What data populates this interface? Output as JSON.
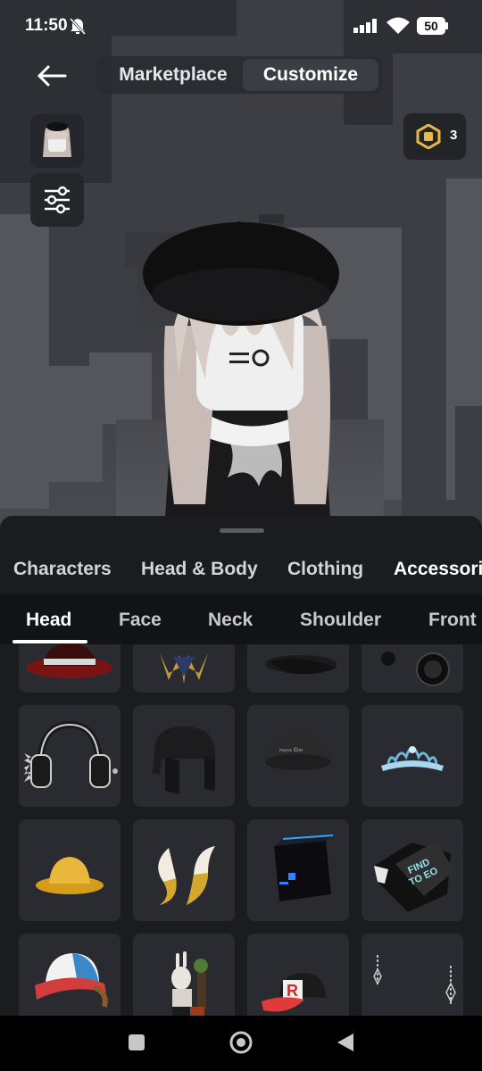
{
  "status_bar": {
    "time": "11:50",
    "battery": "50"
  },
  "header": {
    "tabs": [
      {
        "label": "Marketplace"
      },
      {
        "label": "Customize"
      }
    ],
    "robux_count": "3"
  },
  "categories": [
    {
      "label": "Characters"
    },
    {
      "label": "Head & Body"
    },
    {
      "label": "Clothing"
    },
    {
      "label": "Accessories"
    }
  ],
  "subcategories": [
    {
      "label": "Head"
    },
    {
      "label": "Face"
    },
    {
      "label": "Neck"
    },
    {
      "label": "Shoulder"
    },
    {
      "label": "Front"
    }
  ],
  "items": [
    {
      "icon": "red-black-fedora-icon"
    },
    {
      "icon": "spiked-crown-icon"
    },
    {
      "icon": "black-cap-icon"
    },
    {
      "icon": "jurassic-world-headphones-icon"
    },
    {
      "icon": "spiked-headphones-icon"
    },
    {
      "icon": "black-trapper-hat-icon"
    },
    {
      "icon": "knit-beanie-icon"
    },
    {
      "icon": "blue-tiara-icon"
    },
    {
      "icon": "yellow-bucket-hat-icon"
    },
    {
      "icon": "golden-horns-icon"
    },
    {
      "icon": "blue-visor-cube-icon"
    },
    {
      "icon": "printed-box-hat-icon"
    },
    {
      "icon": "trucker-cap-icon"
    },
    {
      "icon": "bunny-figure-hat-icon"
    },
    {
      "icon": "roblox-cap-icon"
    },
    {
      "icon": "chain-earrings-icon"
    }
  ]
}
